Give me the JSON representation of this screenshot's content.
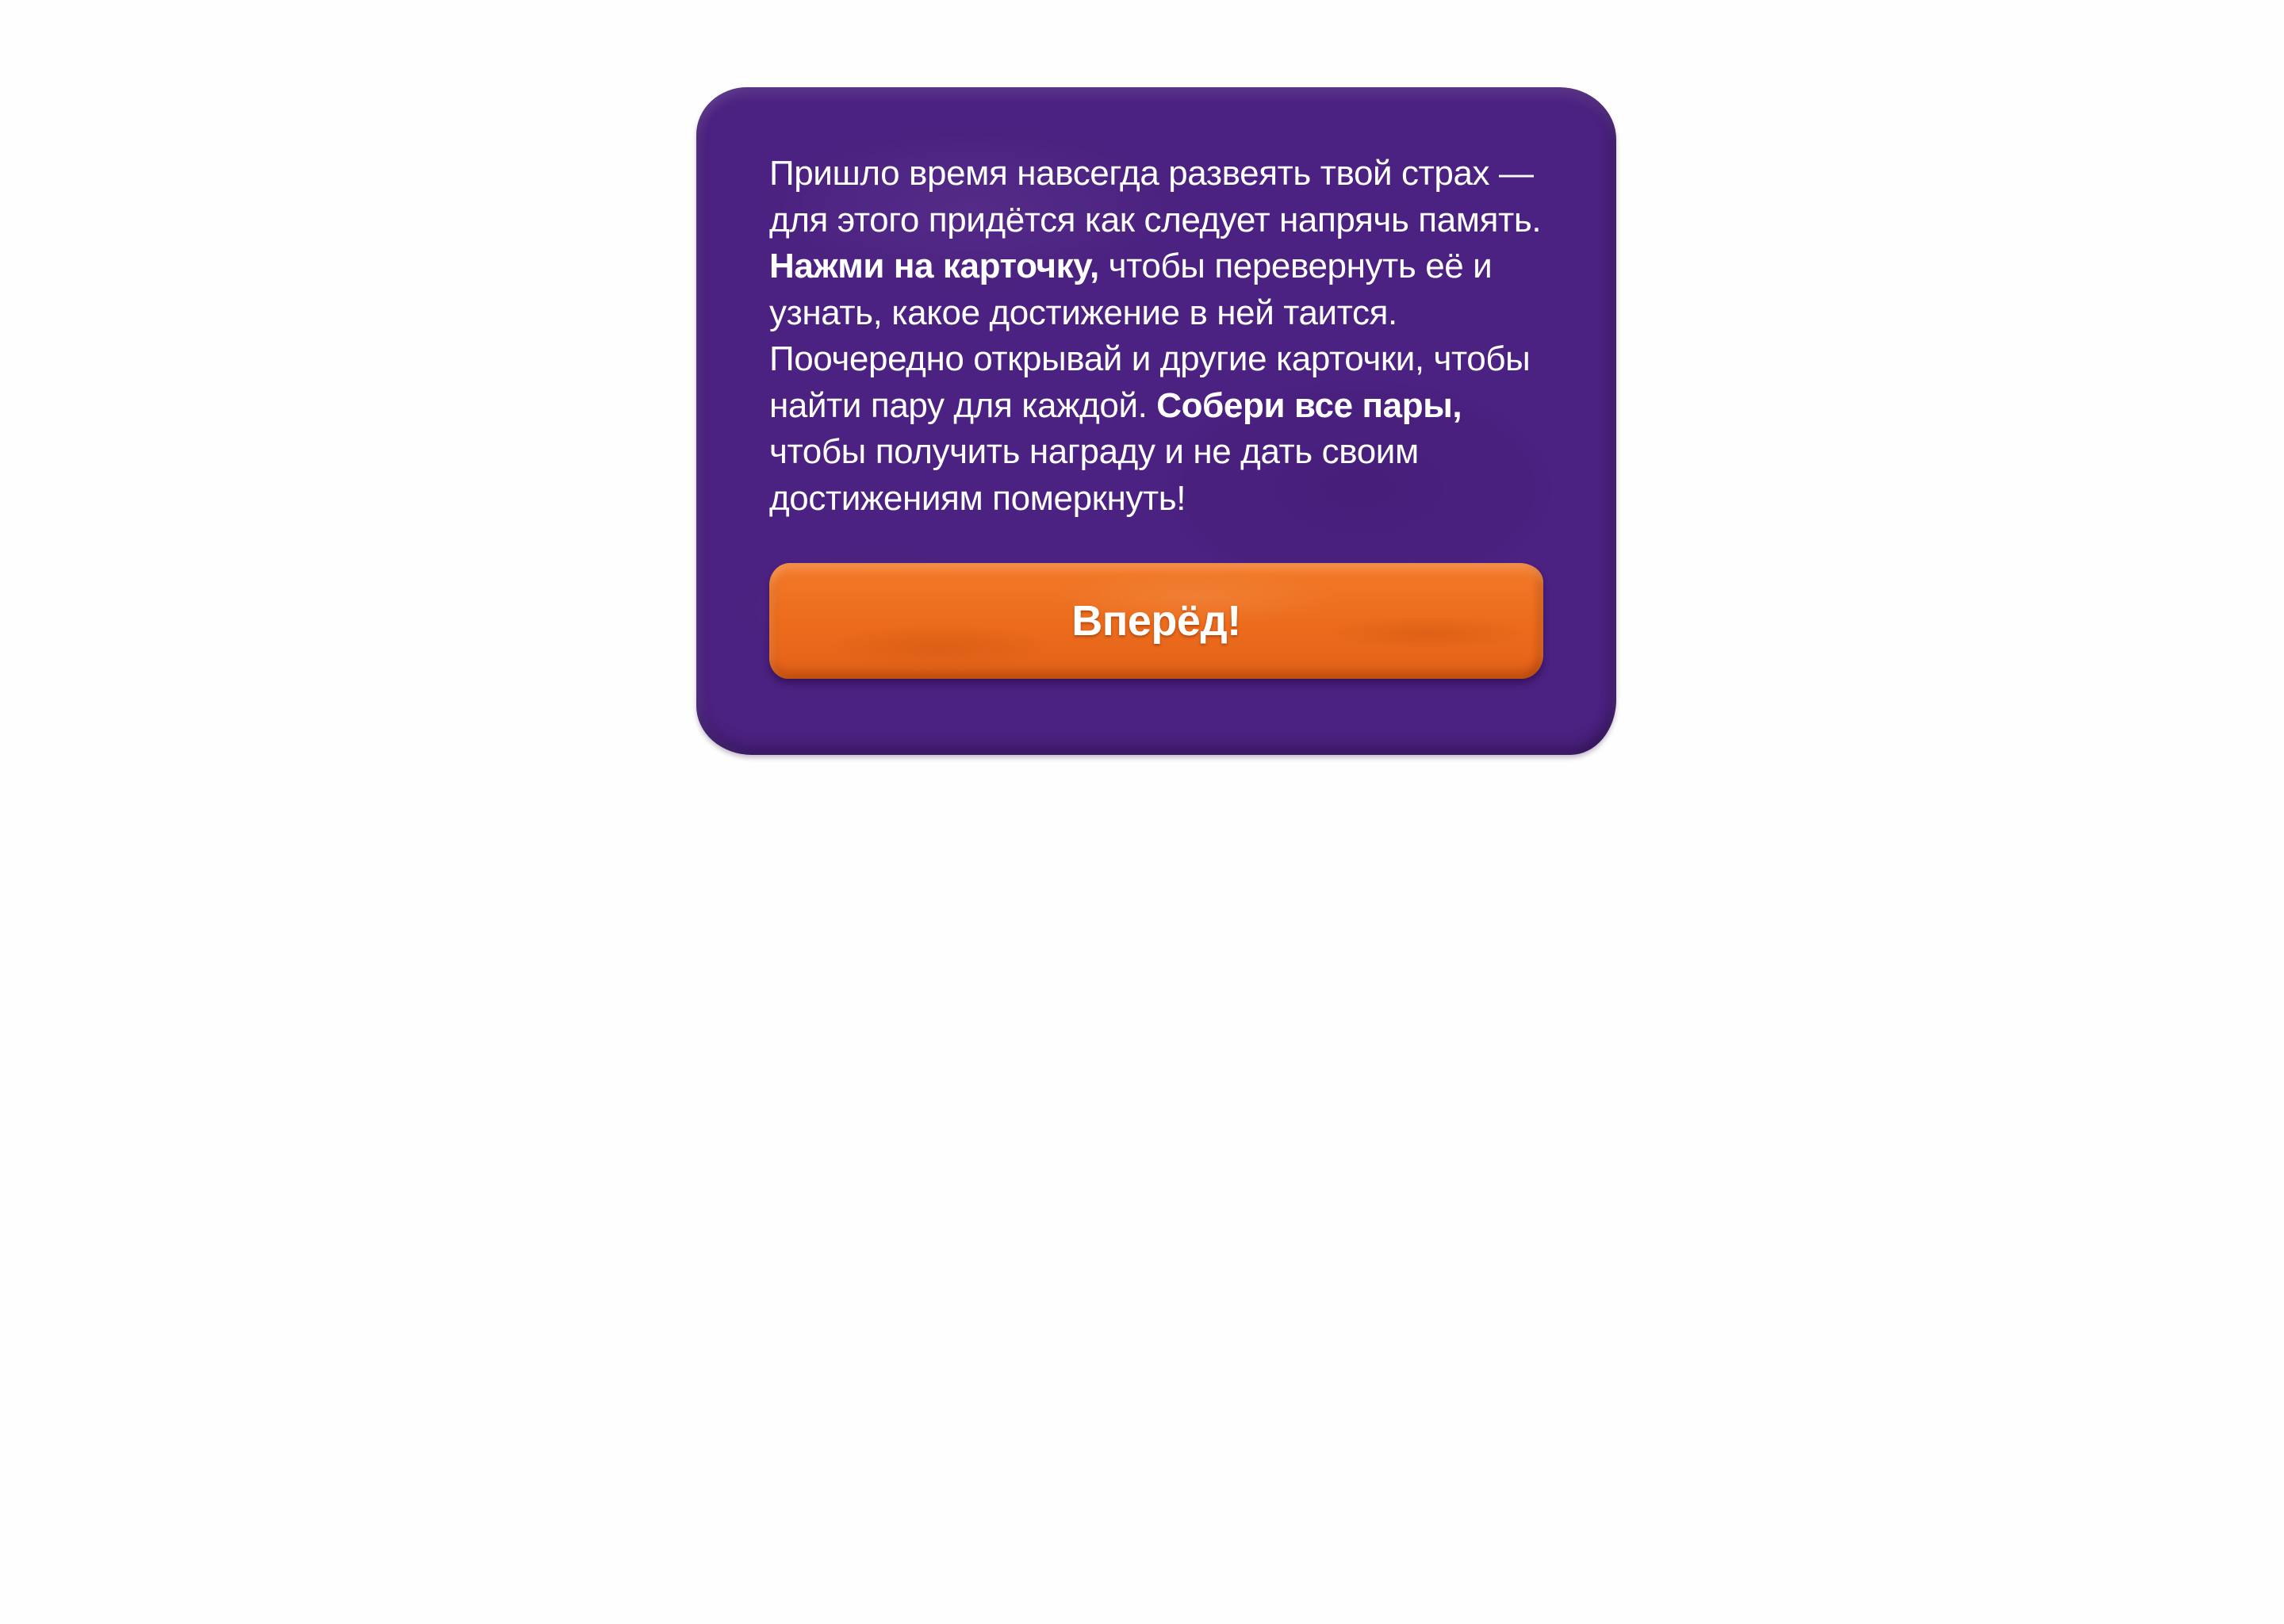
{
  "dialog": {
    "text_1": "Пришло время навсегда развеять твой страх — для этого придётся как следует напрячь память. ",
    "bold_1": "Нажми на карточку,",
    "text_2": " чтобы перевернуть её и узнать, какое достижение в ней таится. Поочередно открывай и другие карточки, чтобы найти пару для каждой. ",
    "bold_2": "Собери все пары,",
    "text_3": " чтобы получить награду и не дать своим достижениям померкнуть!",
    "button_label": "Вперёд!"
  },
  "colors": {
    "card_background": "#4b2181",
    "button_background": "#ec6b1c",
    "page_background": "#fefefe",
    "text": "#ffffff"
  }
}
